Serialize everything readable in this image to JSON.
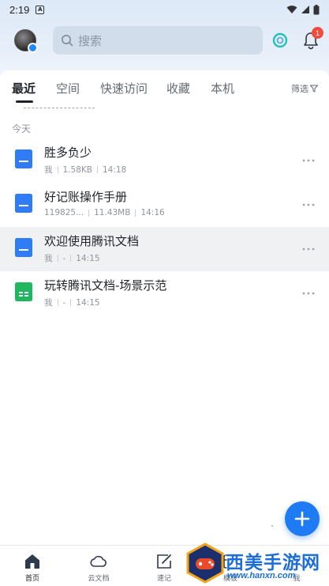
{
  "status_bar": {
    "time": "2:19",
    "notif_letter": "A"
  },
  "header": {
    "search_placeholder": "搜索",
    "bell_badge": "1"
  },
  "tabs": [
    {
      "label": "最近",
      "active": true
    },
    {
      "label": "空间",
      "active": false
    },
    {
      "label": "快速访问",
      "active": false
    },
    {
      "label": "收藏",
      "active": false
    },
    {
      "label": "本机",
      "active": false
    }
  ],
  "filter_label": "筛选",
  "section_label": "今天",
  "files": [
    {
      "title": "胜多负少",
      "type": "doc",
      "meta": [
        "我",
        "1.58KB",
        "14:18"
      ]
    },
    {
      "title": "好记账操作手册",
      "type": "doc",
      "meta": [
        "119825...",
        "11.43MB",
        "14:16"
      ]
    },
    {
      "title": "欢迎使用腾讯文档",
      "type": "doc",
      "meta": [
        "我",
        "-",
        "14:15"
      ],
      "highlighted": true
    },
    {
      "title": "玩转腾讯文档-场景示范",
      "type": "sheet",
      "meta": [
        "我",
        "-",
        "14:15"
      ]
    }
  ],
  "bottom_nav": [
    {
      "label": "首页",
      "icon": "home-icon",
      "active": true
    },
    {
      "label": "云文档",
      "icon": "cloud-icon",
      "active": false
    },
    {
      "label": "速记",
      "icon": "note-edit-icon",
      "active": false
    },
    {
      "label": "模板",
      "icon": "template-icon",
      "active": false
    },
    {
      "label": "我",
      "icon": "user-icon",
      "active": false
    }
  ],
  "watermark": {
    "text": "西美手游网",
    "url": "www.hanxn.com"
  },
  "colors": {
    "accent": "#1e7bf3",
    "doc_icon": "#2f7cf6",
    "sheet_icon": "#1fb85e",
    "badge": "#f04c3e"
  }
}
